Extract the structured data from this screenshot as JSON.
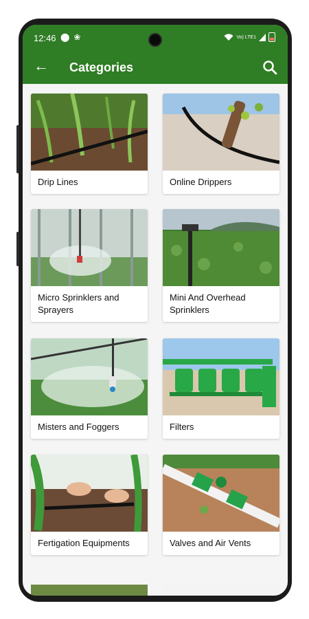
{
  "status_bar": {
    "time": "12:46",
    "network": "Vo) LTE1"
  },
  "app_bar": {
    "title": "Categories"
  },
  "categories": [
    {
      "label": "Drip Lines"
    },
    {
      "label": "Online Drippers"
    },
    {
      "label": "Micro Sprinklers and Sprayers"
    },
    {
      "label": "Mini And Overhead Sprinklers"
    },
    {
      "label": "Misters and Foggers"
    },
    {
      "label": "Filters"
    },
    {
      "label": "Fertigation Equipments"
    },
    {
      "label": "Valves and Air Vents"
    }
  ],
  "colors": {
    "primary": "#2f7d25",
    "background": "#f5f5f5",
    "card": "#ffffff"
  },
  "icons": [
    "back-arrow-icon",
    "search-icon",
    "wifi-icon",
    "signal-icon",
    "battery-icon"
  ]
}
